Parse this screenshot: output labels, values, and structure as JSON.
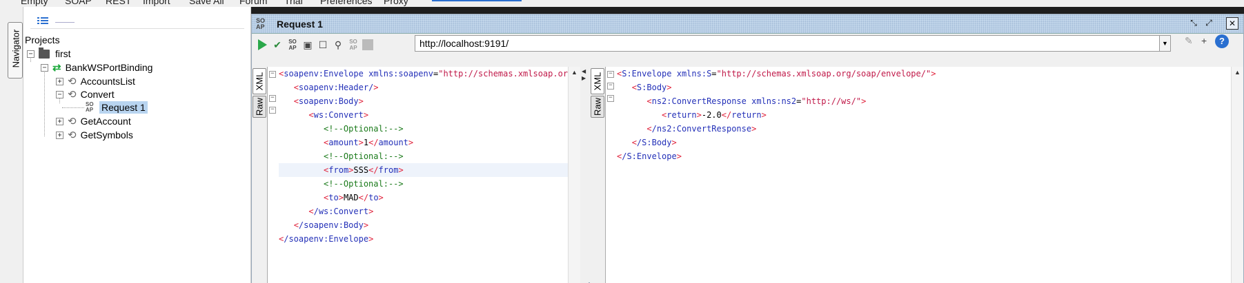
{
  "toolbar": {
    "items": [
      "Empty",
      "SOAP",
      "REST",
      "Import",
      "Save All",
      "Forum",
      "Trial",
      "Preferences",
      "Proxy"
    ]
  },
  "navigator": {
    "label": "Navigator"
  },
  "tree": {
    "root_label": "Projects",
    "project": "first",
    "binding": "BankWSPortBinding",
    "operations": [
      "AccountsList",
      "Convert",
      "GetAccount",
      "GetSymbols"
    ],
    "request": "Request 1",
    "soap_badge": "SO AP"
  },
  "request_window": {
    "title": "Request 1",
    "url": "http://localhost:9191/",
    "tabs_left": [
      "XML",
      "Raw"
    ],
    "tabs_right": [
      "XML",
      "Raw"
    ]
  },
  "request_xml": {
    "envelope_open": "soapenv:Envelope",
    "envelope_attr": "xmlns:soapenv",
    "envelope_ns": "\"http://schemas.xmlsoap.org/soap/envelope/\" xmlns:ws=\"http://ws/\">",
    "header": "soapenv:Header/",
    "body_open": "soapenv:Body",
    "convert_open": "ws:Convert",
    "comment": "<!--Optional:-->",
    "amount_tag": "amount",
    "amount_val": "1",
    "from_tag": "from",
    "from_val": "SSS",
    "to_tag": "to",
    "to_val": "MAD",
    "convert_close": "/ws:Convert",
    "body_close": "/soapenv:Body",
    "envelope_close": "/soapenv:Envelope"
  },
  "response_xml": {
    "envelope_open": "S:Envelope",
    "envelope_attr": "xmlns:S",
    "envelope_ns": "\"http://schemas.xmlsoap.org/soap/envelope/\"",
    "body_open": "S:Body",
    "resp_open": "ns2:ConvertResponse",
    "resp_attr": "xmlns:ns2",
    "resp_ns": "\"http://ws/\"",
    "return_tag": "return",
    "return_val": "-2.0",
    "resp_close": "/ns2:ConvertResponse",
    "body_close": "/S:Body",
    "envelope_close": "/S:Envelope"
  }
}
